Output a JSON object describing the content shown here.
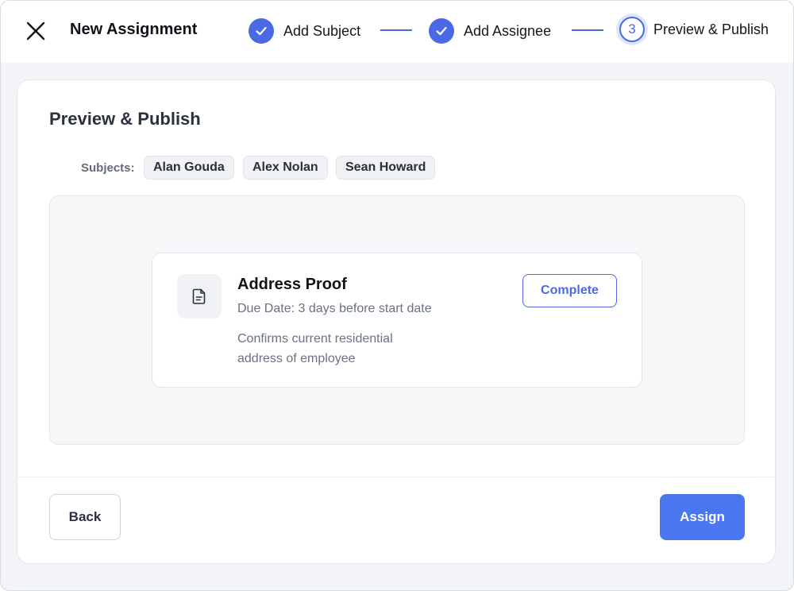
{
  "header": {
    "title": "New Assignment",
    "close_icon": "close-icon"
  },
  "stepper": {
    "steps": [
      {
        "label": "Add Subject",
        "status": "complete",
        "icon": "check-icon"
      },
      {
        "label": "Add Assignee",
        "status": "complete",
        "icon": "check-icon"
      },
      {
        "label": "Preview & Publish",
        "status": "current",
        "number": "3"
      }
    ]
  },
  "main": {
    "title": "Preview & Publish",
    "subjects_label": "Subjects:",
    "subjects": [
      "Alan Gouda",
      "Alex Nolan",
      "Sean Howard"
    ],
    "document": {
      "icon": "document-icon",
      "title": "Address Proof",
      "due_date": "Due Date: 3 days before start date",
      "description": "Confirms current residential address of employee",
      "status_button": "Complete"
    }
  },
  "footer": {
    "back_label": "Back",
    "assign_label": "Assign"
  },
  "colors": {
    "accent": "#4a6ae5",
    "primary_button": "#4a77f0",
    "page_background": "#f2f4f7"
  }
}
